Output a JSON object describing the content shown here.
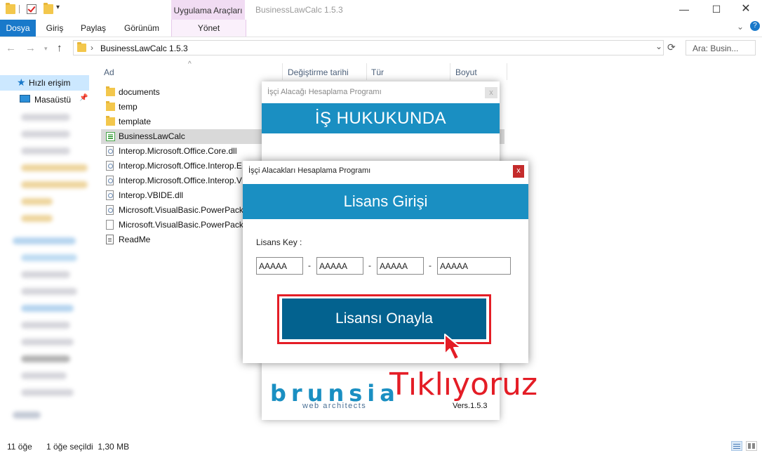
{
  "titlebar": {
    "context_tab_group": "Uygulama Araçları",
    "window_title": "BusinessLawCalc 1.5.3",
    "minimize_icon": "minimize-icon",
    "maximize_icon": "maximize-icon",
    "close_icon": "close-icon"
  },
  "ribbon": {
    "tabs": [
      "Dosya",
      "Giriş",
      "Paylaş",
      "Görünüm",
      "Yönet"
    ]
  },
  "address": {
    "path": "BusinessLawCalc 1.5.3",
    "search_placeholder": "Ara: Busin..."
  },
  "navpane": {
    "quick_access": "Hızlı erişim",
    "desktop": "Masaüstü"
  },
  "filelist": {
    "columns": [
      "Ad",
      "Değiştirme tarihi",
      "Tür",
      "Boyut"
    ],
    "files": [
      {
        "name": "documents",
        "icon": "folder-icon"
      },
      {
        "name": "temp",
        "icon": "folder-icon"
      },
      {
        "name": "template",
        "icon": "folder-icon"
      },
      {
        "name": "BusinessLawCalc",
        "icon": "application-icon"
      },
      {
        "name": "Interop.Microsoft.Office.Core.dll",
        "icon": "dll-icon"
      },
      {
        "name": "Interop.Microsoft.Office.Interop.E",
        "icon": "dll-icon"
      },
      {
        "name": "Interop.Microsoft.Office.Interop.V",
        "icon": "dll-icon"
      },
      {
        "name": "Interop.VBIDE.dll",
        "icon": "dll-icon"
      },
      {
        "name": "Microsoft.VisualBasic.PowerPacks",
        "icon": "dll-icon"
      },
      {
        "name": "Microsoft.VisualBasic.PowerPacks",
        "icon": "document-icon"
      },
      {
        "name": "ReadMe",
        "icon": "text-file-icon"
      }
    ],
    "selected_file": "BusinessLawCalc"
  },
  "statusbar": {
    "item_count": "11 öğe",
    "selection": "1 öğe seçildi  1,30 MB"
  },
  "back_dialog": {
    "title": "İşçi Alacağı Hesaplama Programı",
    "close_label": "x",
    "banner": "İŞ HUKUKUNDA HESAPLAMA",
    "logo": "brunsia",
    "tagline": "web architects",
    "version": "Vers.1.5.3"
  },
  "license_dialog": {
    "title": "İşçi Alacakları Hesaplama Programı",
    "close_label": "x",
    "banner": "Lisans Girişi",
    "key_label": "Lisans Key :",
    "key_parts": [
      "AAAAA",
      "AAAAA",
      "AAAAA",
      "AAAAA"
    ],
    "separator": "-",
    "confirm_button": "Lisansı Onayla"
  },
  "annotation": {
    "text": "Tıklıyoruz",
    "color": "#e41d26"
  },
  "colors": {
    "accent_blue": "#1a8fc2",
    "button_blue": "#03628f",
    "file_tab_blue": "#1979ca",
    "highlight_red": "#e41d26"
  }
}
